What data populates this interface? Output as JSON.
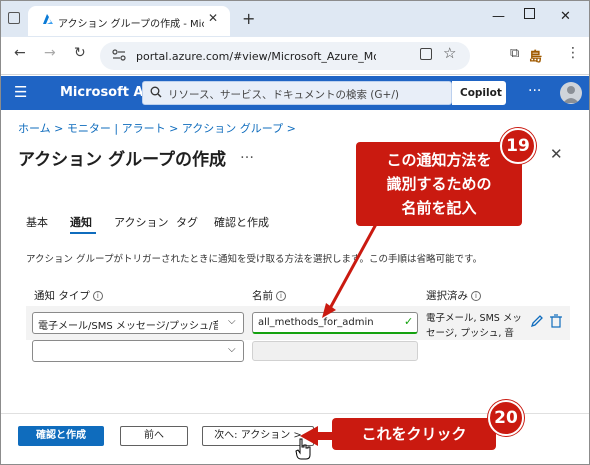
{
  "browser": {
    "tab_title": "アクション グループの作成 - Microsoft Azure",
    "url": "portal.azure.com/#view/Microsoft_Azure_Monitoring",
    "profile_glyph": "島"
  },
  "azure": {
    "brand": "Microsoft Azure",
    "search_placeholder": "リソース、サービス、ドキュメントの検索 (G+/)",
    "copilot": "Copilot"
  },
  "page": {
    "breadcrumb": "ホーム > モニター | アラート > アクション グループ >",
    "title": "アクション グループの作成",
    "title_more": "…",
    "tabs": [
      "基本",
      "通知",
      "アクション",
      "タグ",
      "確認と作成"
    ],
    "active_tab": "通知",
    "description": "アクション グループがトリガーされたときに通知を受け取る方法を選択します。この手順は省略可能です。"
  },
  "grid": {
    "col_type": "通知 タイプ",
    "col_name": "名前",
    "col_selected": "選択済み",
    "row1": {
      "type": "電子メール/SMS メッセージ/プッシュ/音声",
      "name": "all_methods_for_admin",
      "selected": "電子メール, SMS メッセージ, プッシュ, 音声"
    }
  },
  "footer": {
    "review_create": "確認と作成",
    "prev": "前へ",
    "next": "次へ: アクション >"
  },
  "annotations": {
    "callout19_line1": "この通知方法を",
    "callout19_line2": "識別するための",
    "callout19_line3": "名前を記入",
    "badge19": "19",
    "callout20": "これをクリック",
    "badge20": "20"
  },
  "colors": {
    "azure_header": "#1f64c4",
    "primary": "#0f6cbd",
    "callout": "#ca1a10"
  }
}
